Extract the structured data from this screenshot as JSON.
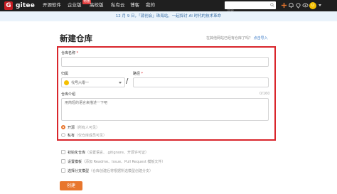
{
  "nav": {
    "logo_mark": "G",
    "brand": "gitee",
    "items": [
      "开源软件",
      "企业版",
      "高校版",
      "私有云",
      "博客",
      "我的"
    ],
    "badge": "特惠",
    "search_placeholder": "搜索",
    "avatar_letter": "U",
    "icons": [
      "plus-icon",
      "bell-icon",
      "location-icon",
      "eye-icon"
    ]
  },
  "announcement": "12 月 9 日，「源创会」珠海站，一起探讨 AI 时代的技术革命",
  "page": {
    "title": "新建仓库",
    "import_text": "在其他网站已经有仓库了吗？",
    "import_link": "点击导入"
  },
  "form": {
    "repo_name_label": "仓库名称",
    "repo_name_placeholder": "",
    "owner_label": "归属",
    "owner_value": "代号六零一",
    "path_label": "路径",
    "path_value": "",
    "desc_label": "仓库介绍",
    "desc_placeholder": "用简短的语言来描述一下吧",
    "desc_counter": "0/160",
    "visibility": [
      {
        "label": "开源",
        "note": "（所有人可见）",
        "checked": true
      },
      {
        "label": "私有",
        "note": "（仅仓库成员可见）",
        "checked": false
      }
    ],
    "options": [
      {
        "label": "初始化仓库",
        "note": "（设置语言、.gitignore、开源许可证）"
      },
      {
        "label": "设置模板",
        "note": "（添加 Readme、Issue、Pull Request 模板文件）"
      },
      {
        "label": "选择分支模型",
        "note": "（仓库创建后将根据所选模型创建分支）"
      }
    ],
    "create_label": "创建"
  },
  "colors": {
    "accent": "#e8762d",
    "highlight_box": "#d9262c",
    "brand": "#c71d23"
  }
}
